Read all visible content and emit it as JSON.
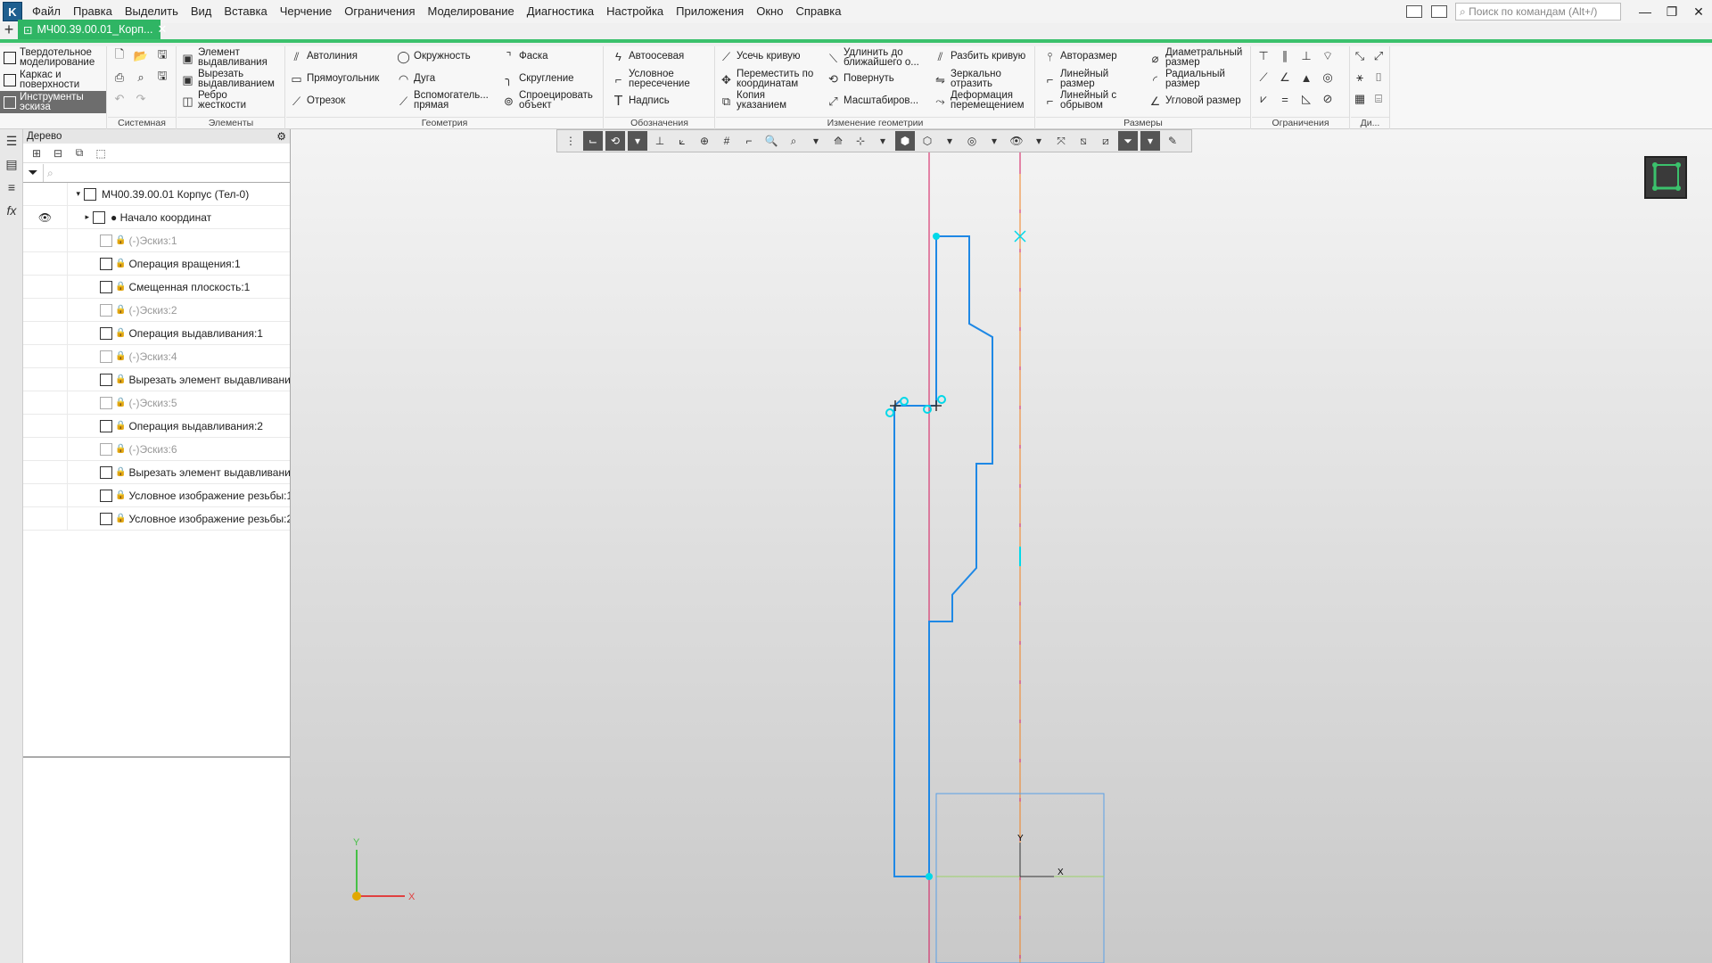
{
  "menubar": {
    "items": [
      "Файл",
      "Правка",
      "Выделить",
      "Вид",
      "Вставка",
      "Черчение",
      "Ограничения",
      "Моделирование",
      "Диагностика",
      "Настройка",
      "Приложения",
      "Окно",
      "Справка"
    ],
    "search_placeholder": "Поиск по командам (Alt+/)"
  },
  "tab": {
    "title": "МЧ00.39.00.01_Корп..."
  },
  "modes": [
    "Твердотельное моделирование",
    "Каркас и поверхности",
    "Инструменты эскиза"
  ],
  "ribbon": {
    "groups": [
      "Системная",
      "Элементы",
      "Геометрия",
      "Обозначения",
      "Изменение геометрии",
      "Размеры",
      "Ограничения",
      "Ди..."
    ],
    "elements": [
      "Элемент выдавливания",
      "Вырезать выдавливанием",
      "Ребро жесткости"
    ],
    "geometry": [
      "Автолиния",
      "Прямоугольник",
      "Отрезок",
      "Окружность",
      "Дуга",
      "Вспомогатель... прямая",
      "Фаска",
      "Скругление",
      "Спроецировать объект"
    ],
    "annotations": [
      "Автоосевая",
      "Условное пересечение",
      "Надпись"
    ],
    "modify": [
      "Усечь кривую",
      "Переместить по координатам",
      "Копия указанием",
      "Удлинить до ближайшего о...",
      "Повернуть",
      "Масштабиров...",
      "Разбить кривую",
      "Зеркально отразить",
      "Деформация перемещением"
    ],
    "dims": [
      "Авторазмер",
      "Линейный размер",
      "Линейный с обрывом",
      "Диаметральный размер",
      "Радиальный размер",
      "Угловой размер"
    ]
  },
  "tree": {
    "title": "Дерево",
    "search_placeholder": "⌕",
    "rows": [
      {
        "label": "МЧ00.39.00.01 Корпус (Тел-0)",
        "lock": "",
        "indent": 52,
        "dim": false
      },
      {
        "label": "● Начало координат",
        "lock": "",
        "indent": 62,
        "dim": false,
        "eye": "👁"
      },
      {
        "label": "(-)Эскиз:1",
        "lock": "🔒",
        "indent": 70,
        "dim": true
      },
      {
        "label": "Операция вращения:1",
        "lock": "🔒",
        "indent": 70,
        "dim": false
      },
      {
        "label": "Смещенная плоскость:1",
        "lock": "🔒",
        "indent": 70,
        "dim": false
      },
      {
        "label": "(-)Эскиз:2",
        "lock": "🔒",
        "indent": 70,
        "dim": true
      },
      {
        "label": "Операция выдавливания:1",
        "lock": "🔒",
        "indent": 70,
        "dim": false
      },
      {
        "label": "(-)Эскиз:4",
        "lock": "🔒",
        "indent": 70,
        "dim": true
      },
      {
        "label": "Вырезать элемент выдавливания",
        "lock": "🔒",
        "indent": 70,
        "dim": false
      },
      {
        "label": "(-)Эскиз:5",
        "lock": "🔒",
        "indent": 70,
        "dim": true
      },
      {
        "label": "Операция выдавливания:2",
        "lock": "🔒",
        "indent": 70,
        "dim": false
      },
      {
        "label": "(-)Эскиз:6",
        "lock": "🔒",
        "indent": 70,
        "dim": true
      },
      {
        "label": "Вырезать элемент выдавливания",
        "lock": "🔒",
        "indent": 70,
        "dim": false
      },
      {
        "label": "Условное изображение резьбы:1",
        "lock": "🔒",
        "indent": 70,
        "dim": false
      },
      {
        "label": "Условное изображение резьбы:2",
        "lock": "🔒",
        "indent": 70,
        "dim": false
      }
    ]
  },
  "axes": {
    "x": "X",
    "y": "Y"
  },
  "colors": {
    "accent": "#2fb564",
    "sketch": "#1e88e5",
    "axis_red": "#d4145a",
    "axis_orange": "#f08020",
    "point": "#00d8e8"
  }
}
